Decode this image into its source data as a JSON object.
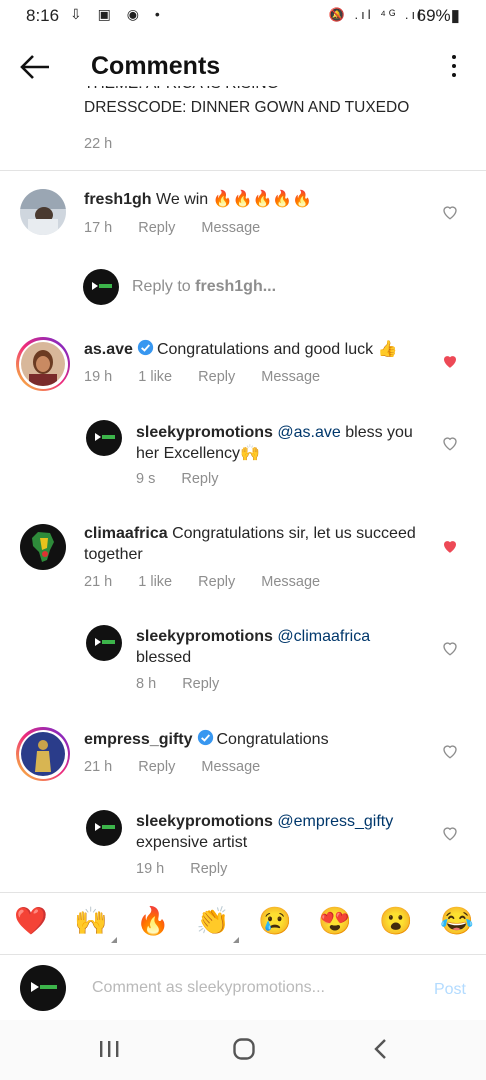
{
  "status_bar": {
    "time": "8:16",
    "left_icons": "⇩ ▣ ◉ •",
    "right_icons": "🔕 .ıl ⁴ᴳ .ıl",
    "battery": "69%▮"
  },
  "header": {
    "title": "Comments",
    "back_icon": "arrow-left-icon",
    "more_icon": "more-vertical-icon"
  },
  "caption": {
    "cut_line": "THEME: AFRICA IS RISING",
    "last_line": "DRESSCODE: DINNER GOWN AND TUXEDO",
    "time": "22 h"
  },
  "comments": [
    {
      "username": "fresh1gh",
      "text": "We win 🔥🔥🔥🔥🔥",
      "time": "17 h",
      "reply": "Reply",
      "message": "Message",
      "liked": false
    },
    {
      "username": "as.ave",
      "verified": true,
      "text": "Congratulations and good luck 👍",
      "time": "19 h",
      "likes": "1 like",
      "reply": "Reply",
      "message": "Message",
      "liked": true,
      "reply_comment": {
        "username": "sleekypromotions",
        "mention": "@as.ave",
        "text": "bless you her Excellency🙌",
        "time": "9 s",
        "reply": "Reply"
      }
    },
    {
      "username": "climaafrica",
      "text": "Congratulations sir, let us succeed together",
      "time": "21 h",
      "likes": "1 like",
      "reply": "Reply",
      "message": "Message",
      "liked": true,
      "reply_comment": {
        "username": "sleekypromotions",
        "mention": "@climaafrica",
        "text": "blessed",
        "time": "8 h",
        "reply": "Reply"
      }
    },
    {
      "username": "empress_gifty",
      "verified": true,
      "text": "Congratulations",
      "time": "21 h",
      "reply": "Reply",
      "message": "Message",
      "liked": false,
      "reply_comment": {
        "username": "sleekypromotions",
        "mention": "@empress_gifty",
        "text": "expensive artist",
        "time": "19 h",
        "reply": "Reply"
      }
    }
  ],
  "reply_prompt": {
    "prefix": "Reply to",
    "username": "fresh1gh..."
  },
  "emoji_bar": [
    "❤️",
    "🙌",
    "🔥",
    "👏",
    "😢",
    "😍",
    "😮",
    "😂"
  ],
  "composer": {
    "placeholder": "Comment as sleekypromotions...",
    "post_label": "Post"
  },
  "colors": {
    "like_red": "#ed4956",
    "mention_blue": "#00376b",
    "verified_blue": "#3897f0",
    "post_disabled": "#b3dbff"
  }
}
